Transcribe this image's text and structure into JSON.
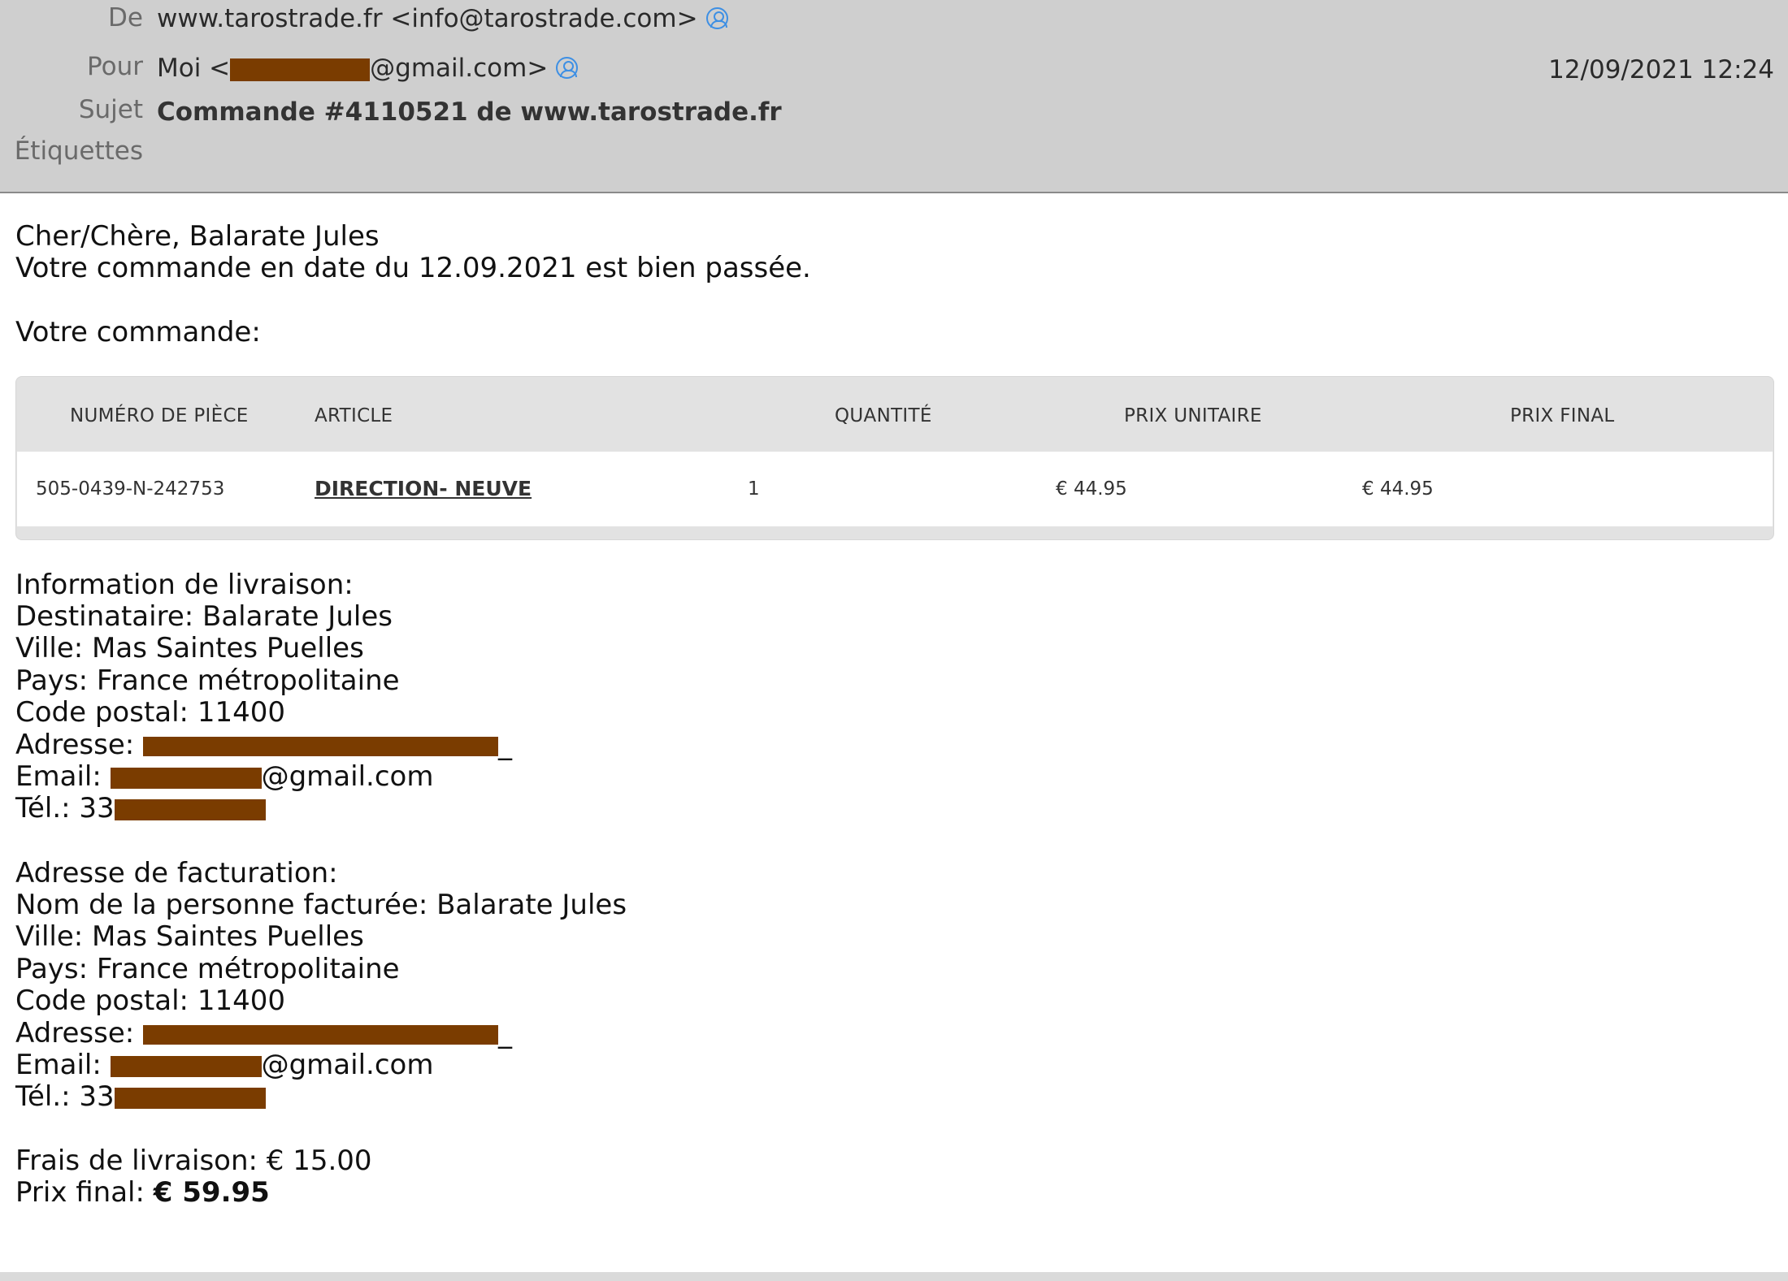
{
  "header": {
    "from_label": "De",
    "from_value": "www.tarostrade.fr <info@tarostrade.com>",
    "to_label": "Pour",
    "to_prefix": "Moi <",
    "to_suffix": "@gmail.com>",
    "subject_label": "Sujet",
    "subject_value": "Commande #4110521 de www.tarostrade.fr",
    "tags_label": "Étiquettes",
    "date": "12/09/2021 12:24"
  },
  "body": {
    "greeting": "Cher/Chère, Balarate Jules",
    "order_date_line": "Votre commande en date du 12.09.2021 est bien passée.",
    "order_heading": "Votre commande:"
  },
  "table": {
    "headers": [
      "NUMÉRO DE PIÈCE",
      "ARTICLE",
      "QUANTITÉ",
      "PRIX UNITAIRE",
      "PRIX FINAL"
    ],
    "rows": [
      {
        "part_number": "505-0439-N-242753",
        "article": "DIRECTION- NEUVE",
        "quantity": "1",
        "unit_price": "€ 44.95",
        "final_price": "€ 44.95"
      }
    ]
  },
  "delivery": {
    "heading": "Information de livraison:",
    "recipient": "Destinataire: Balarate Jules",
    "city": "Ville: Mas Saintes Puelles",
    "country": "Pays: France métropolitaine",
    "postal": "Code postal: 11400",
    "address_label": "Adresse: ",
    "address_tail": "_",
    "email_label": "Email: ",
    "email_suffix": "@gmail.com",
    "phone_label": "Tél.: 33"
  },
  "billing": {
    "heading": "Adresse de facturation:",
    "name": "Nom de la personne facturée: Balarate Jules",
    "city": "Ville: Mas Saintes Puelles",
    "country": "Pays: France métropolitaine",
    "postal": "Code postal: 11400",
    "address_label": "Adresse: ",
    "address_tail": "_",
    "email_label": "Email: ",
    "email_suffix": "@gmail.com",
    "phone_label": "Tél.: 33"
  },
  "totals": {
    "shipping": "Frais de livraison: € 15.00",
    "final_label": "Prix final: ",
    "final_value": "€ 59.95"
  },
  "colors": {
    "header_bg": "#cfcfcf",
    "redaction": "#7a3c00",
    "contact_icon": "#3d8fe4"
  }
}
